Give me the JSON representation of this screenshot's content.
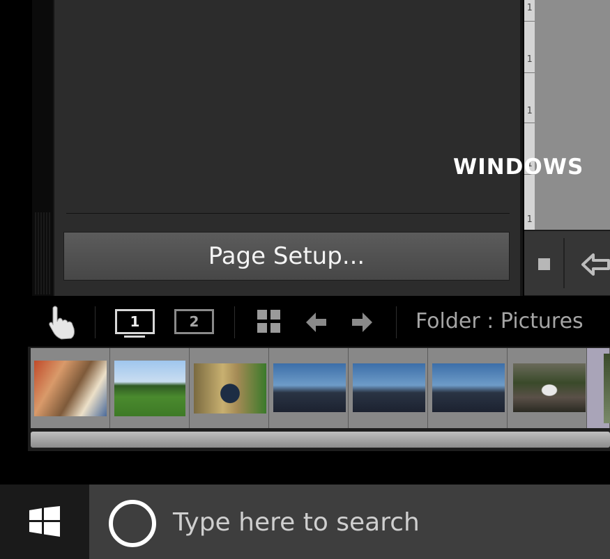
{
  "panel": {
    "page_setup_label": "Page Setup..."
  },
  "ruler": {
    "tick_labels": [
      "1",
      "1",
      "1",
      "1",
      "1"
    ]
  },
  "watermark": {
    "text": "WINDOWS"
  },
  "filmstrip_toolbar": {
    "display_1_label": "1",
    "display_2_label": "2",
    "source_label": "Folder : Pictures"
  },
  "filmstrip": {
    "thumbnails": [
      {
        "name": "people-dog-couch-thumbnail"
      },
      {
        "name": "dog-on-grass-thumbnail"
      },
      {
        "name": "man-portrait-thumbnail"
      },
      {
        "name": "city-skyline-thumbnail-1"
      },
      {
        "name": "city-skyline-thumbnail-2"
      },
      {
        "name": "city-skyline-thumbnail-3"
      },
      {
        "name": "waterfall-thumbnail"
      },
      {
        "name": "partial-thumbnail"
      }
    ]
  },
  "taskbar": {
    "search_placeholder": "Type here to search"
  },
  "colors": {
    "panel_bg": "#2c2c2c",
    "button_bg": "#525252",
    "filmstrip_cell": "#888888",
    "taskbar_bg": "#343434"
  }
}
